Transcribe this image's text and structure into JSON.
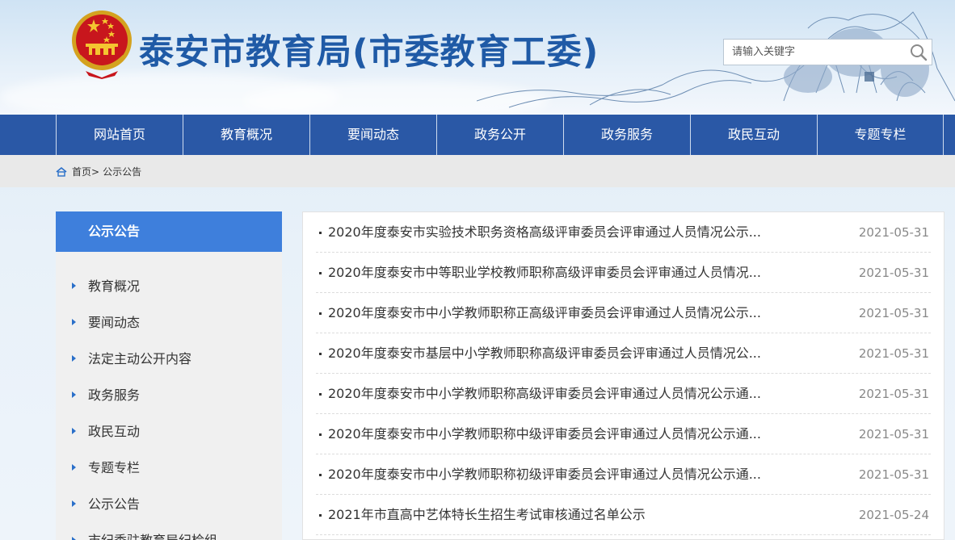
{
  "header": {
    "site_title": "泰安市教育局(市委教育工委)",
    "search_placeholder": "请输入关键字"
  },
  "nav": {
    "items": [
      {
        "label": "网站首页"
      },
      {
        "label": "教育概况"
      },
      {
        "label": "要闻动态"
      },
      {
        "label": "政务公开"
      },
      {
        "label": "政务服务"
      },
      {
        "label": "政民互动"
      },
      {
        "label": "专题专栏"
      }
    ]
  },
  "breadcrumb": {
    "home": "首页",
    "separator": ">",
    "current": "公示公告"
  },
  "sidebar": {
    "heading": "公示公告",
    "items": [
      {
        "label": "教育概况"
      },
      {
        "label": "要闻动态"
      },
      {
        "label": "法定主动公开内容"
      },
      {
        "label": "政务服务"
      },
      {
        "label": "政民互动"
      },
      {
        "label": "专题专栏"
      },
      {
        "label": "公示公告"
      },
      {
        "label": "市纪委驻教育局纪检组"
      }
    ]
  },
  "news": [
    {
      "title": "2020年度泰安市实验技术职务资格高级评审委员会评审通过人员情况公示...",
      "date": "2021-05-31"
    },
    {
      "title": "2020年度泰安市中等职业学校教师职称高级评审委员会评审通过人员情况...",
      "date": "2021-05-31"
    },
    {
      "title": "2020年度泰安市中小学教师职称正高级评审委员会评审通过人员情况公示...",
      "date": "2021-05-31"
    },
    {
      "title": "2020年度泰安市基层中小学教师职称高级评审委员会评审通过人员情况公...",
      "date": "2021-05-31"
    },
    {
      "title": "2020年度泰安市中小学教师职称高级评审委员会评审通过人员情况公示通...",
      "date": "2021-05-31"
    },
    {
      "title": "2020年度泰安市中小学教师职称中级评审委员会评审通过人员情况公示通...",
      "date": "2021-05-31"
    },
    {
      "title": "2020年度泰安市中小学教师职称初级评审委员会评审通过人员情况公示通...",
      "date": "2021-05-31"
    },
    {
      "title": "2021年市直高中艺体特长生招生考试审核通过名单公示",
      "date": "2021-05-24"
    }
  ],
  "colors": {
    "nav_bg": "#2a58a6",
    "title_blue": "#1f5aa6",
    "side_head_bg": "#3e7fdc",
    "arrow": "#2a6fc9"
  },
  "icons": {
    "emblem": "national-emblem-icon",
    "search": "search-icon",
    "home": "home-icon",
    "arrow": "triangle-right-icon"
  }
}
